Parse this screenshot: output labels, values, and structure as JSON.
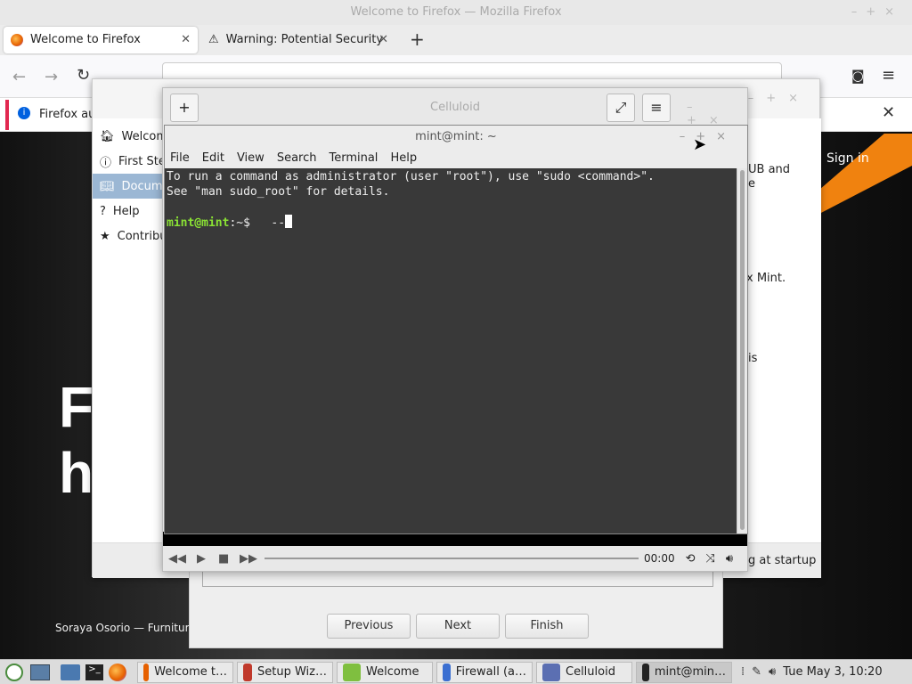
{
  "firefox": {
    "window_title": "Welcome to Firefox — Mozilla Firefox",
    "tabs": [
      {
        "label": "Welcome to Firefox",
        "close": "✕"
      },
      {
        "label": "Warning: Potential Security",
        "close": "✕"
      }
    ],
    "new_tab": "+",
    "notification": "Firefox au",
    "page": {
      "headline": "F\nh",
      "sign_in": "Sign in",
      "credit": "Soraya Osorio — Furniture c"
    }
  },
  "welcome": {
    "sidebar": [
      {
        "label": "Welcome",
        "icon": "home-icon"
      },
      {
        "label": "First Steps",
        "icon": "info-icon"
      },
      {
        "label": "Documentation",
        "icon": "book-icon"
      },
      {
        "label": "Help",
        "icon": "help-icon"
      },
      {
        "label": "Contribute",
        "icon": "star-icon"
      }
    ],
    "right_text": [
      "UB and",
      "e",
      "x Mint.",
      "is"
    ],
    "startup_text": "g at startup"
  },
  "wizard": {
    "buttons": [
      "Previous",
      "Next",
      "Finish"
    ]
  },
  "celluloid": {
    "title": "Celluloid",
    "add": "+",
    "time": "00:00"
  },
  "terminal": {
    "title": "mint@mint: ~",
    "menu": [
      "File",
      "Edit",
      "View",
      "Search",
      "Terminal",
      "Help"
    ],
    "line1": "To run a command as administrator (user \"root\"), use \"sudo <command>\".",
    "line2": "See \"man sudo_root\" for details.",
    "prompt_user": "mint@mint",
    "prompt_path": ":~$",
    "typed": "   --"
  },
  "taskbar": {
    "items": [
      {
        "label": "Welcome t…"
      },
      {
        "label": "Setup Wiz…"
      },
      {
        "label": "Welcome"
      },
      {
        "label": "Firewall (a…"
      },
      {
        "label": "Celluloid"
      },
      {
        "label": "mint@min…"
      }
    ],
    "clock": "Tue May  3, 10:20"
  }
}
